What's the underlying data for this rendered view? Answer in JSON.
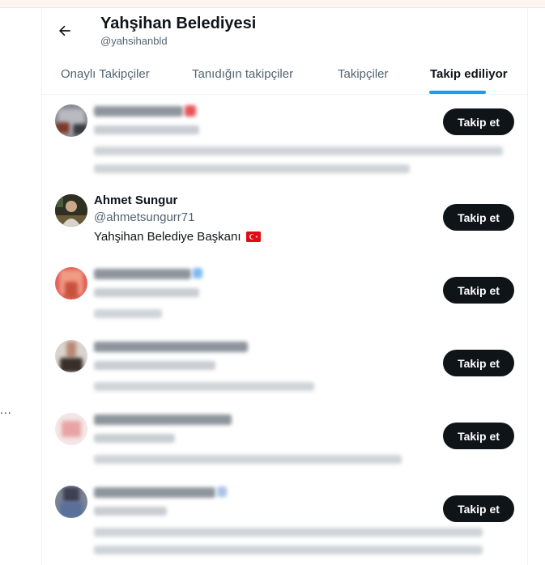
{
  "header": {
    "title": "Yahşihan Belediyesi",
    "handle": "@yahsihanbld"
  },
  "tabs": [
    {
      "label": "Onaylı Takipçiler",
      "active": false
    },
    {
      "label": "Tanıdığın takipçiler",
      "active": false
    },
    {
      "label": "Takipçiler",
      "active": false
    },
    {
      "label": "Takip ediliyor",
      "active": true
    }
  ],
  "users": [
    {
      "blurred": true,
      "follow_label": "Takip et"
    },
    {
      "blurred": false,
      "name": "Ahmet Sungur",
      "handle": "@ahmetsungurr71",
      "bio": "Yahşihan Belediye Başkanı",
      "bio_flag": "turkey-flag",
      "follow_label": "Takip et"
    },
    {
      "blurred": true,
      "follow_label": "Takip et"
    },
    {
      "blurred": true,
      "follow_label": "Takip et"
    },
    {
      "blurred": true,
      "follow_label": "Takip et"
    },
    {
      "blurred": true,
      "follow_label": "Takip et"
    }
  ],
  "side": {
    "ellipsis": "..."
  },
  "colors": {
    "accent": "#1d9bf0",
    "button_bg": "#0f1419",
    "muted": "#536471"
  }
}
